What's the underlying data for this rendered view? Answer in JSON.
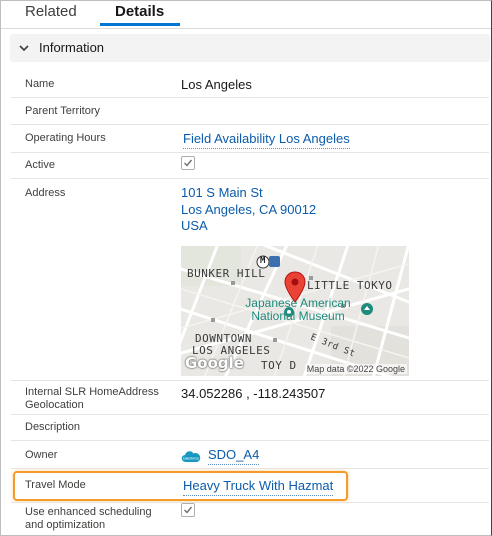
{
  "tabs": {
    "related": "Related",
    "details": "Details"
  },
  "section": {
    "title": "Information"
  },
  "fields": {
    "name": {
      "label": "Name",
      "value": "Los Angeles"
    },
    "parent_territory": {
      "label": "Parent Territory",
      "value": ""
    },
    "operating_hours": {
      "label": "Operating Hours",
      "value": "Field Availability Los Angeles"
    },
    "active": {
      "label": "Active",
      "checked": true
    },
    "address": {
      "label": "Address",
      "line1": "101 S Main St",
      "line2": "Los Angeles, CA 90012",
      "line3": "USA"
    },
    "geolocation": {
      "label_line1": "Internal SLR HomeAddress",
      "label_line2": "Geolocation",
      "value": "34.052286 , -118.243507"
    },
    "description": {
      "label": "Description",
      "value": ""
    },
    "owner": {
      "label": "Owner",
      "badge": "salesforce",
      "value": "SDO_A4"
    },
    "travel_mode": {
      "label": "Travel Mode",
      "value": "Heavy Truck With Hazmat"
    },
    "enhanced": {
      "label_line1": "Use enhanced scheduling",
      "label_line2": "and optimization",
      "checked": true
    }
  },
  "map": {
    "metro_badge": "M",
    "area1": "BUNKER HILL",
    "area2": "LITTLE TOKYO",
    "area3_line1": "DOWNTOWN",
    "area3_line2": "LOS ANGELES",
    "area4": "TOY D",
    "street": "E 3rd St",
    "poi_line1": "Japanese American",
    "poi_line2": "National Museum",
    "google": "Google",
    "credit": "Map data ©2022 Google"
  },
  "colors": {
    "link": "#0b5cab",
    "tab_active": "#0176d3",
    "highlight": "#f59b2b",
    "pin": "#ea4335"
  }
}
